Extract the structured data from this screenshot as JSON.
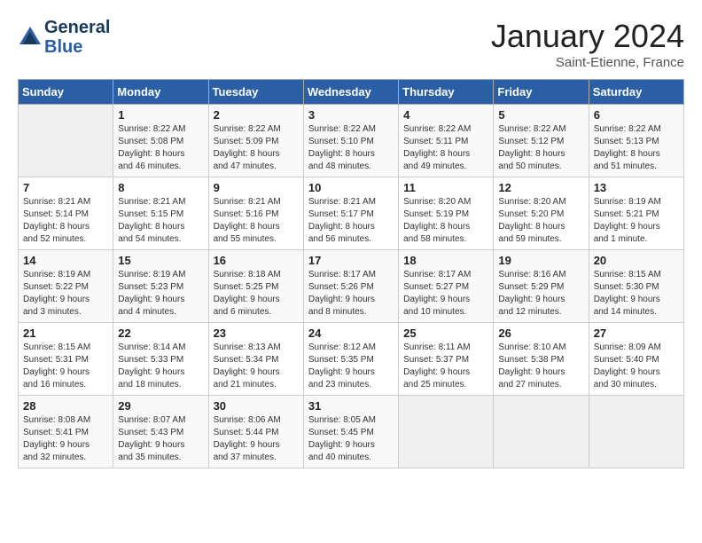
{
  "header": {
    "logo_line1": "General",
    "logo_line2": "Blue",
    "month": "January 2024",
    "location": "Saint-Etienne, France"
  },
  "weekdays": [
    "Sunday",
    "Monday",
    "Tuesday",
    "Wednesday",
    "Thursday",
    "Friday",
    "Saturday"
  ],
  "weeks": [
    [
      {
        "day": "",
        "info": ""
      },
      {
        "day": "1",
        "info": "Sunrise: 8:22 AM\nSunset: 5:08 PM\nDaylight: 8 hours\nand 46 minutes."
      },
      {
        "day": "2",
        "info": "Sunrise: 8:22 AM\nSunset: 5:09 PM\nDaylight: 8 hours\nand 47 minutes."
      },
      {
        "day": "3",
        "info": "Sunrise: 8:22 AM\nSunset: 5:10 PM\nDaylight: 8 hours\nand 48 minutes."
      },
      {
        "day": "4",
        "info": "Sunrise: 8:22 AM\nSunset: 5:11 PM\nDaylight: 8 hours\nand 49 minutes."
      },
      {
        "day": "5",
        "info": "Sunrise: 8:22 AM\nSunset: 5:12 PM\nDaylight: 8 hours\nand 50 minutes."
      },
      {
        "day": "6",
        "info": "Sunrise: 8:22 AM\nSunset: 5:13 PM\nDaylight: 8 hours\nand 51 minutes."
      }
    ],
    [
      {
        "day": "7",
        "info": "Sunrise: 8:21 AM\nSunset: 5:14 PM\nDaylight: 8 hours\nand 52 minutes."
      },
      {
        "day": "8",
        "info": "Sunrise: 8:21 AM\nSunset: 5:15 PM\nDaylight: 8 hours\nand 54 minutes."
      },
      {
        "day": "9",
        "info": "Sunrise: 8:21 AM\nSunset: 5:16 PM\nDaylight: 8 hours\nand 55 minutes."
      },
      {
        "day": "10",
        "info": "Sunrise: 8:21 AM\nSunset: 5:17 PM\nDaylight: 8 hours\nand 56 minutes."
      },
      {
        "day": "11",
        "info": "Sunrise: 8:20 AM\nSunset: 5:19 PM\nDaylight: 8 hours\nand 58 minutes."
      },
      {
        "day": "12",
        "info": "Sunrise: 8:20 AM\nSunset: 5:20 PM\nDaylight: 8 hours\nand 59 minutes."
      },
      {
        "day": "13",
        "info": "Sunrise: 8:19 AM\nSunset: 5:21 PM\nDaylight: 9 hours\nand 1 minute."
      }
    ],
    [
      {
        "day": "14",
        "info": "Sunrise: 8:19 AM\nSunset: 5:22 PM\nDaylight: 9 hours\nand 3 minutes."
      },
      {
        "day": "15",
        "info": "Sunrise: 8:19 AM\nSunset: 5:23 PM\nDaylight: 9 hours\nand 4 minutes."
      },
      {
        "day": "16",
        "info": "Sunrise: 8:18 AM\nSunset: 5:25 PM\nDaylight: 9 hours\nand 6 minutes."
      },
      {
        "day": "17",
        "info": "Sunrise: 8:17 AM\nSunset: 5:26 PM\nDaylight: 9 hours\nand 8 minutes."
      },
      {
        "day": "18",
        "info": "Sunrise: 8:17 AM\nSunset: 5:27 PM\nDaylight: 9 hours\nand 10 minutes."
      },
      {
        "day": "19",
        "info": "Sunrise: 8:16 AM\nSunset: 5:29 PM\nDaylight: 9 hours\nand 12 minutes."
      },
      {
        "day": "20",
        "info": "Sunrise: 8:15 AM\nSunset: 5:30 PM\nDaylight: 9 hours\nand 14 minutes."
      }
    ],
    [
      {
        "day": "21",
        "info": "Sunrise: 8:15 AM\nSunset: 5:31 PM\nDaylight: 9 hours\nand 16 minutes."
      },
      {
        "day": "22",
        "info": "Sunrise: 8:14 AM\nSunset: 5:33 PM\nDaylight: 9 hours\nand 18 minutes."
      },
      {
        "day": "23",
        "info": "Sunrise: 8:13 AM\nSunset: 5:34 PM\nDaylight: 9 hours\nand 21 minutes."
      },
      {
        "day": "24",
        "info": "Sunrise: 8:12 AM\nSunset: 5:35 PM\nDaylight: 9 hours\nand 23 minutes."
      },
      {
        "day": "25",
        "info": "Sunrise: 8:11 AM\nSunset: 5:37 PM\nDaylight: 9 hours\nand 25 minutes."
      },
      {
        "day": "26",
        "info": "Sunrise: 8:10 AM\nSunset: 5:38 PM\nDaylight: 9 hours\nand 27 minutes."
      },
      {
        "day": "27",
        "info": "Sunrise: 8:09 AM\nSunset: 5:40 PM\nDaylight: 9 hours\nand 30 minutes."
      }
    ],
    [
      {
        "day": "28",
        "info": "Sunrise: 8:08 AM\nSunset: 5:41 PM\nDaylight: 9 hours\nand 32 minutes."
      },
      {
        "day": "29",
        "info": "Sunrise: 8:07 AM\nSunset: 5:43 PM\nDaylight: 9 hours\nand 35 minutes."
      },
      {
        "day": "30",
        "info": "Sunrise: 8:06 AM\nSunset: 5:44 PM\nDaylight: 9 hours\nand 37 minutes."
      },
      {
        "day": "31",
        "info": "Sunrise: 8:05 AM\nSunset: 5:45 PM\nDaylight: 9 hours\nand 40 minutes."
      },
      {
        "day": "",
        "info": ""
      },
      {
        "day": "",
        "info": ""
      },
      {
        "day": "",
        "info": ""
      }
    ]
  ]
}
